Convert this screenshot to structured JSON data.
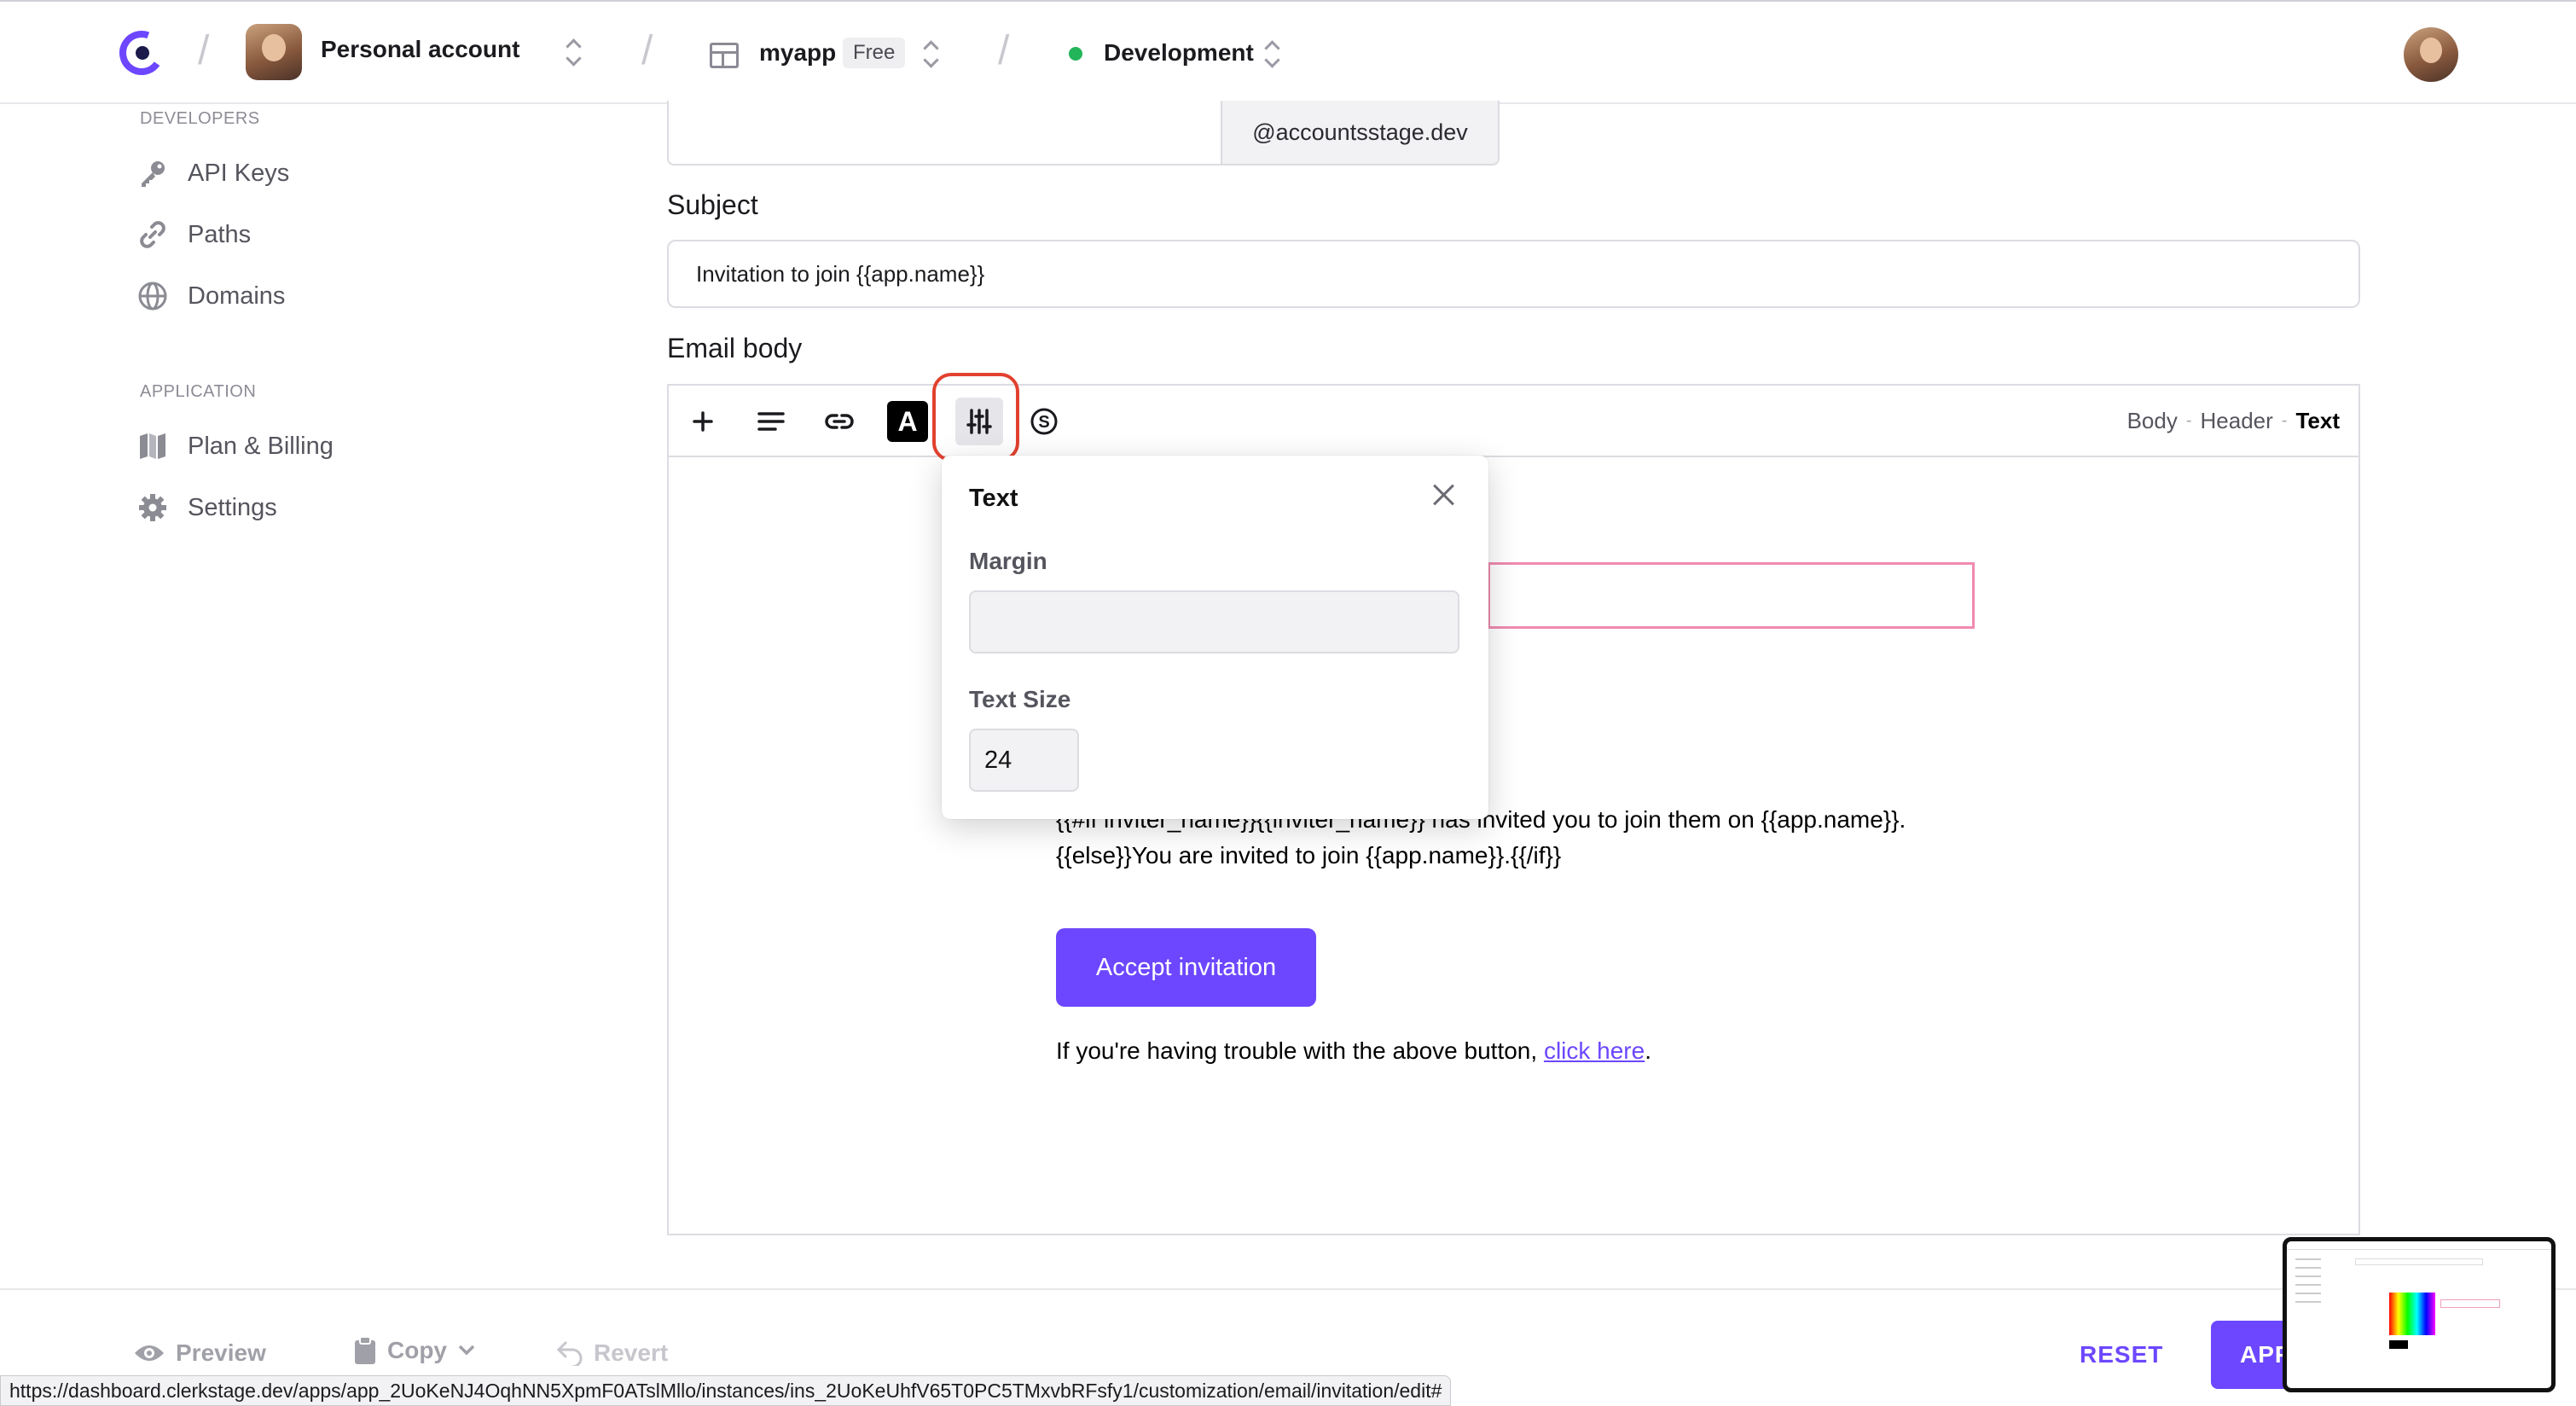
{
  "header": {
    "account_name": "Personal account",
    "app_name": "myapp",
    "plan_badge": "Free",
    "environment": "Development"
  },
  "sidebar": {
    "sections": [
      {
        "label": "DEVELOPERS",
        "items": [
          {
            "label": "API Keys",
            "icon": "key-icon"
          },
          {
            "label": "Paths",
            "icon": "link-icon"
          },
          {
            "label": "Domains",
            "icon": "globe-icon"
          }
        ]
      },
      {
        "label": "APPLICATION",
        "items": [
          {
            "label": "Plan & Billing",
            "icon": "map-icon"
          },
          {
            "label": "Settings",
            "icon": "gear-icon"
          }
        ]
      }
    ]
  },
  "form": {
    "from_suffix": "@accountsstage.dev",
    "subject_label": "Subject",
    "subject_value": "Invitation to join {{app.name}}",
    "body_label": "Email body"
  },
  "editor": {
    "toolbar": [
      {
        "name": "add-block-button",
        "icon": "plus-icon"
      },
      {
        "name": "align-button",
        "icon": "align-icon"
      },
      {
        "name": "link-button",
        "icon": "link-icon"
      },
      {
        "name": "text-color-button",
        "icon": "text-color-icon",
        "glyph": "A"
      },
      {
        "name": "style-settings-button",
        "icon": "sliders-icon",
        "active": true
      },
      {
        "name": "variables-button",
        "icon": "dollar-circle-icon"
      }
    ],
    "breadcrumb": [
      "Body",
      "Header",
      "Text"
    ],
    "breadcrumb_current": "Text",
    "body_line1": "{{#if inviter_name}}{{inviter_name}} has invited you to join them on {{app.name}}.",
    "body_line2": "{{else}}You are invited to join {{app.name}}.{{/if}}",
    "accept_button": "Accept invitation",
    "trouble_text": "If you're having trouble with the above button, ",
    "trouble_link": "click here",
    "trouble_end": "."
  },
  "popover": {
    "title": "Text",
    "margin_label": "Margin",
    "margin_value": "",
    "text_size_label": "Text Size",
    "text_size_value": "24"
  },
  "bottom_bar": {
    "preview": "Preview",
    "copy": "Copy",
    "revert": "Revert",
    "reset": "RESET",
    "apply": "APP"
  },
  "status_url": "https://dashboard.clerkstage.dev/apps/app_2UoKeNJ4OqhNN5XpmF0ATslMllo/instances/ins_2UoKeUhfV65T0PC5TMxvbRFsfy1/customization/email/invitation/edit#",
  "colors": {
    "accent": "#6c47ff",
    "focus_ring": "#e2412f",
    "env_dot": "#22b55a",
    "selection_outline": "#f08bb0"
  }
}
